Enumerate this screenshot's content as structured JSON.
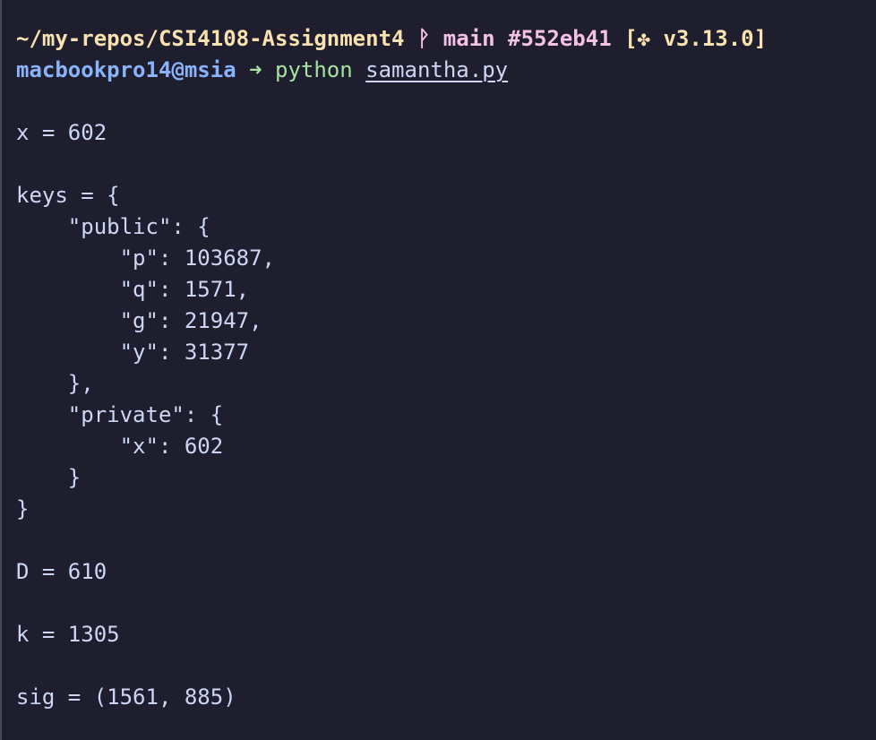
{
  "prompt": {
    "path": "~/my-repos/CSI4108-Assignment4",
    "branch_icon": "ᚹ",
    "branch": "main",
    "commit": "#552eb41",
    "version_open": "[",
    "version_icon": "✤",
    "version": "v3.13.0]",
    "user_host": "macbookpro14@msia",
    "arrow": "➜",
    "command": "python",
    "argument": "samantha.py"
  },
  "output_lines": [
    "",
    "x = 602",
    "",
    "keys = {",
    "    \"public\": {",
    "        \"p\": 103687,",
    "        \"q\": 1571,",
    "        \"g\": 21947,",
    "        \"y\": 31377",
    "    },",
    "    \"private\": {",
    "        \"x\": 602",
    "    }",
    "}",
    "",
    "D = 610",
    "",
    "k = 1305",
    "",
    "sig = (1561, 885)"
  ],
  "icons": {
    "branch": "git-branch-icon",
    "python_version": "python-icon"
  },
  "colors": {
    "background": "#1e1e2e",
    "text": "#cdd6f4",
    "path": "#f9e2af",
    "branch": "#f5c2e7",
    "user": "#89b4fa",
    "command": "#a6e3a1"
  }
}
